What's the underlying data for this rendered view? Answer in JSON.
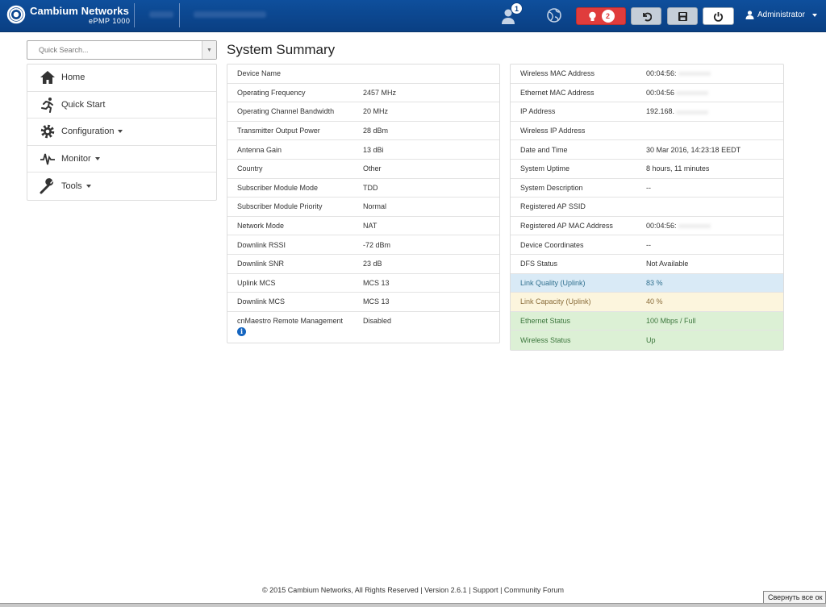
{
  "header": {
    "brand": "Cambium Networks",
    "model": "ePMP 1000",
    "user_badge": "1",
    "alert_count": "2",
    "admin_label": "Administrator",
    "icons": [
      "cambium-logo-icon",
      "user-icon",
      "globe-icon",
      "alert-bulb-icon",
      "undo-icon",
      "save-icon",
      "power-icon",
      "person-icon"
    ],
    "colors": {
      "bar": "#0a3f83",
      "alert": "#e03c3c"
    }
  },
  "search": {
    "placeholder": "Quick Search..."
  },
  "sidebar": {
    "items": [
      {
        "label": "Home",
        "icon": "home-icon"
      },
      {
        "label": "Quick Start",
        "icon": "running-man-icon"
      },
      {
        "label": "Configuration",
        "icon": "gear-icon",
        "dropdown": true
      },
      {
        "label": "Monitor",
        "icon": "pulse-icon",
        "dropdown": true
      },
      {
        "label": "Tools",
        "icon": "wrench-icon",
        "dropdown": true
      }
    ]
  },
  "page": {
    "title": "System Summary"
  },
  "left_table": [
    {
      "key": "Device Name",
      "value": ""
    },
    {
      "key": "Operating Frequency",
      "value": "2457 MHz"
    },
    {
      "key": "Operating Channel Bandwidth",
      "value": "20 MHz"
    },
    {
      "key": "Transmitter Output Power",
      "value": "28 dBm"
    },
    {
      "key": "Antenna Gain",
      "value": "13 dBi"
    },
    {
      "key": "Country",
      "value": "Other"
    },
    {
      "key": "Subscriber Module Mode",
      "value": "TDD"
    },
    {
      "key": "Subscriber Module Priority",
      "value": "Normal"
    },
    {
      "key": "Network Mode",
      "value": "NAT"
    },
    {
      "key": "Downlink RSSI",
      "value": "-72 dBm"
    },
    {
      "key": "Downlink SNR",
      "value": "23 dB"
    },
    {
      "key": "Uplink MCS",
      "value": "MCS 13"
    },
    {
      "key": "Downlink MCS",
      "value": "MCS 13"
    },
    {
      "key": "cnMaestro Remote Management",
      "value": "Disabled"
    }
  ],
  "right_table": [
    {
      "key": "Wireless MAC Address",
      "value": "00:04:56:"
    },
    {
      "key": "Ethernet MAC Address",
      "value": "00:04:56"
    },
    {
      "key": "IP Address",
      "value": "192.168."
    },
    {
      "key": "Wireless IP Address",
      "value": ""
    },
    {
      "key": "Date and Time",
      "value": "30 Mar 2016, 14:23:18 EEDT"
    },
    {
      "key": "System Uptime",
      "value": "8 hours, 11 minutes"
    },
    {
      "key": "System Description",
      "value": "--"
    },
    {
      "key": "Registered AP SSID",
      "value": ""
    },
    {
      "key": "Registered AP MAC Address",
      "value": "00:04:56:"
    },
    {
      "key": "Device Coordinates",
      "value": "--"
    },
    {
      "key": "DFS Status",
      "value": "Not Available"
    },
    {
      "key": "Link Quality (Uplink)",
      "value": "83 %",
      "status": "blue"
    },
    {
      "key": "Link Capacity (Uplink)",
      "value": "40 %",
      "status": "yellow"
    },
    {
      "key": "Ethernet Status",
      "value": "100 Mbps / Full",
      "status": "green"
    },
    {
      "key": "Wireless Status",
      "value": "Up",
      "status": "green"
    }
  ],
  "footer": {
    "copyright": "© 2015 Cambium Networks, All Rights Reserved",
    "version": "Version 2.6.1",
    "support": "Support",
    "forum": "Community Forum"
  },
  "os": {
    "collapse_all": "Свернуть все ок"
  }
}
